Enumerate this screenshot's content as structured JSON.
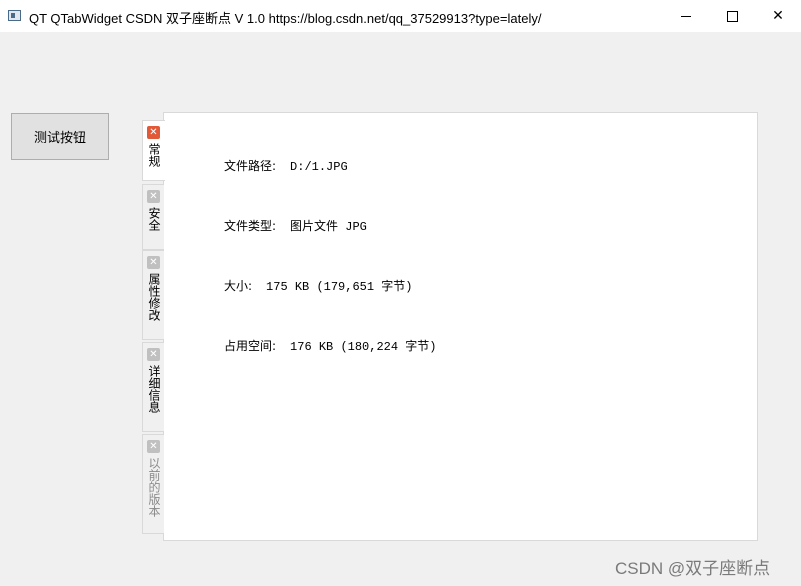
{
  "window": {
    "title": "QT QTabWidget  CSDN 双子座断点 V 1.0 https://blog.csdn.net/qq_37529913?type=lately/",
    "close_glyph": "✕"
  },
  "test_button": {
    "label": "测试按钮"
  },
  "tabs": [
    {
      "label": "常规",
      "active": true
    },
    {
      "label": "安全",
      "active": false
    },
    {
      "label": "属性修改",
      "active": false
    },
    {
      "label": "详细信息",
      "active": false
    },
    {
      "label": "以前的版本",
      "active": false,
      "disabled": true
    }
  ],
  "tab_close_glyph": "✕",
  "info": {
    "path_label": "文件路径:",
    "path_value": "D:/1.JPG",
    "type_label": "文件类型:",
    "type_value": "图片文件 JPG",
    "size_label": "大小:",
    "size_value": "175 KB (179,651 字节)",
    "disk_label": "占用空间:",
    "disk_value": "176 KB (180,224 字节)"
  },
  "watermark": "CSDN @双子座断点",
  "colors": {
    "active_close": "#e05a3a",
    "inactive_close": "#c0c0c0"
  }
}
